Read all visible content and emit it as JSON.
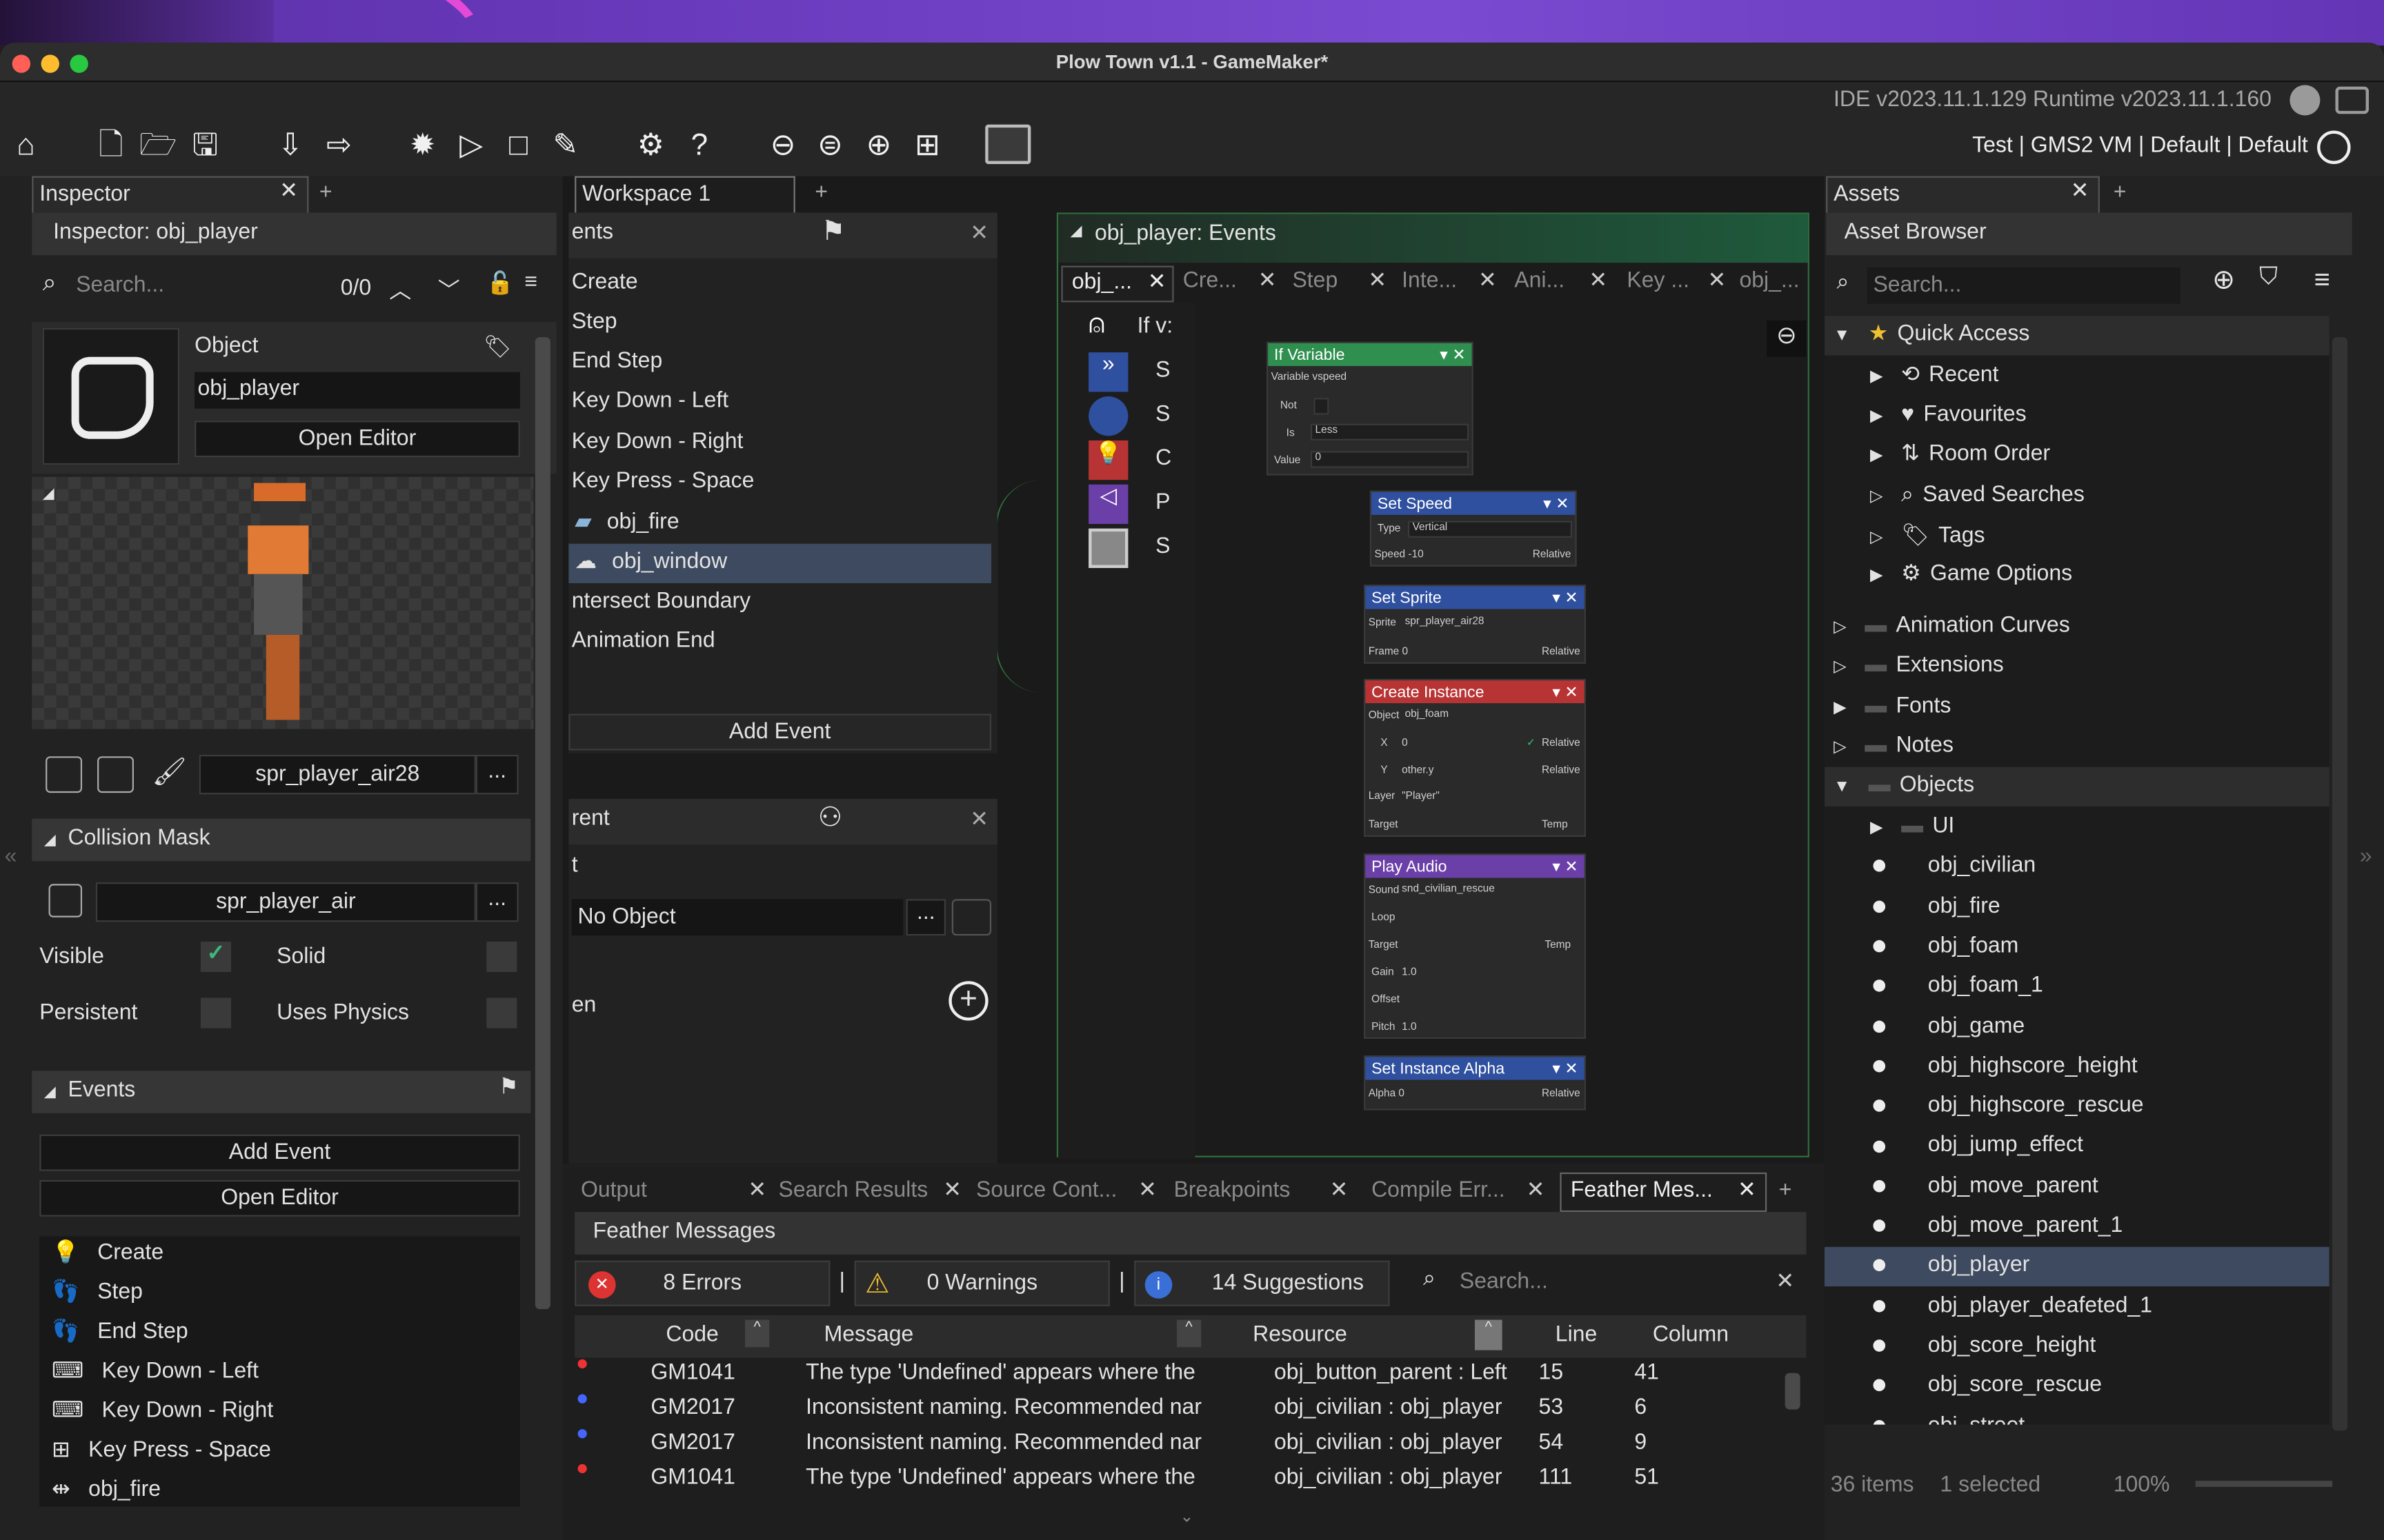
{
  "window": {
    "title": "Plow Town v1.1 - GameMaker*",
    "ide_version": "IDE v2023.11.1.129  Runtime v2023.11.1.160",
    "target": "Test | GMS2 VM | Default | Default"
  },
  "inspector": {
    "tab": "Inspector",
    "header": "Inspector: obj_player",
    "search_placeholder": "Search...",
    "search_count": "0/0",
    "object_label": "Object",
    "object_name": "obj_player",
    "open_editor": "Open Editor",
    "sprite_name": "spr_player_air28",
    "collision_mask_label": "Collision Mask",
    "mask_sprite": "spr_player_air",
    "visible": "Visible",
    "solid": "Solid",
    "persistent": "Persistent",
    "uses_physics": "Uses Physics",
    "events_label": "Events",
    "add_event": "Add Event",
    "open_editor2": "Open Editor",
    "events": [
      "Create",
      "Step",
      "End Step",
      "Key Down - Left",
      "Key Down - Right",
      "Key Press - Space",
      "obj_fire"
    ],
    "more": "..."
  },
  "workspace": {
    "tab": "Workspace 1",
    "events_panel_title": "ents",
    "event_list": [
      "Create",
      "Step",
      "End Step",
      "Key Down - Left",
      "Key Down - Right",
      "Key Press - Space",
      "obj_fire",
      "obj_window",
      "ntersect Boundary",
      "Animation End"
    ],
    "add_event": "Add Event",
    "parent_panel_title": "rent",
    "parent_t": "t",
    "no_object": "No Object",
    "parent_en": "en"
  },
  "code_editor": {
    "title": "obj_player: Events",
    "tabs": [
      "obj_...",
      "Cre...",
      "Step",
      "Inte...",
      "Ani...",
      "Key ...",
      "obj_..."
    ],
    "side_events": [
      "If v:",
      "S",
      "S",
      "C",
      "P",
      "S"
    ],
    "nodes": {
      "if_variable": {
        "title": "If Variable",
        "variable": "Variable vspeed",
        "not": "Not",
        "is": "Is",
        "is_value": "Less",
        "value_label": "Value",
        "value": "0"
      },
      "set_speed": {
        "title": "Set Speed",
        "type_label": "Type",
        "type_value": "Vertical",
        "speed": "Speed -10",
        "relative": "Relative"
      },
      "set_sprite": {
        "title": "Set Sprite",
        "sprite_label": "Sprite",
        "sprite_value": "spr_player_air28",
        "frame": "Frame 0",
        "relative": "Relative"
      },
      "create_instance": {
        "title": "Create Instance",
        "object_label": "Object",
        "object_value": "obj_foam",
        "x_label": "X",
        "x_value": "0",
        "y_label": "Y",
        "y_value": "other.y",
        "layer_label": "Layer",
        "layer_value": "\"Player\"",
        "target": "Target",
        "relative": "Relative",
        "temp": "Temp"
      },
      "play_audio": {
        "title": "Play Audio",
        "sound_label": "Sound",
        "sound_value": "snd_civilian_rescue",
        "loop": "Loop",
        "target": "Target",
        "temp": "Temp",
        "gain": "Gain",
        "gain_value": "1.0",
        "offset": "Offset",
        "pitch": "Pitch",
        "pitch_value": "1.0"
      },
      "set_alpha": {
        "title": "Set Instance Alpha",
        "alpha": "Alpha 0",
        "relative": "Relative"
      }
    }
  },
  "output": {
    "tabs": [
      "Output",
      "Search Results",
      "Source Cont...",
      "Breakpoints",
      "Compile Err...",
      "Feather Mes..."
    ],
    "title": "Feather Messages",
    "errors": "8 Errors",
    "warnings": "0 Warnings",
    "suggestions": "14 Suggestions",
    "search_placeholder": "Search...",
    "columns": [
      "Code",
      "Message",
      "Resource",
      "Line",
      "Column"
    ],
    "rows": [
      {
        "code": "GM1041",
        "message": "The type 'Undefined' appears where the",
        "resource": "obj_button_parent : Left",
        "line": "15",
        "column": "41",
        "sev": "error"
      },
      {
        "code": "GM2017",
        "message": "Inconsistent naming. Recommended nar",
        "resource": "obj_civilian : obj_player",
        "line": "53",
        "column": "6",
        "sev": "info"
      },
      {
        "code": "GM2017",
        "message": "Inconsistent naming. Recommended nar",
        "resource": "obj_civilian : obj_player",
        "line": "54",
        "column": "9",
        "sev": "info"
      },
      {
        "code": "GM1041",
        "message": "The type 'Undefined' appears where the",
        "resource": "obj_civilian : obj_player",
        "line": "111",
        "column": "51",
        "sev": "error"
      }
    ]
  },
  "assets": {
    "tab": "Assets",
    "header": "Asset Browser",
    "search_placeholder": "Search...",
    "quick_access": "Quick Access",
    "quick_items": [
      "Recent",
      "Favourites",
      "Room Order",
      "Saved Searches",
      "Tags",
      "Game Options"
    ],
    "folders": [
      "Animation Curves",
      "Extensions",
      "Fonts",
      "Notes",
      "Objects"
    ],
    "objects": [
      "UI",
      "obj_civilian",
      "obj_fire",
      "obj_foam",
      "obj_foam_1",
      "obj_game",
      "obj_highscore_height",
      "obj_highscore_rescue",
      "obj_jump_effect",
      "obj_move_parent",
      "obj_move_parent_1",
      "obj_player",
      "obj_player_deafeted_1",
      "obj_score_height",
      "obj_score_rescue",
      "obj_street"
    ],
    "status_items": "36 items",
    "status_selected": "1 selected",
    "zoom": "100%"
  },
  "colors": {
    "accent_green": "#3cb878",
    "node_green": "#2f8f4f",
    "node_blue": "#2f4f9f",
    "node_red": "#b83434",
    "node_purple": "#6b3fa8",
    "selected": "#3d4a5f"
  }
}
